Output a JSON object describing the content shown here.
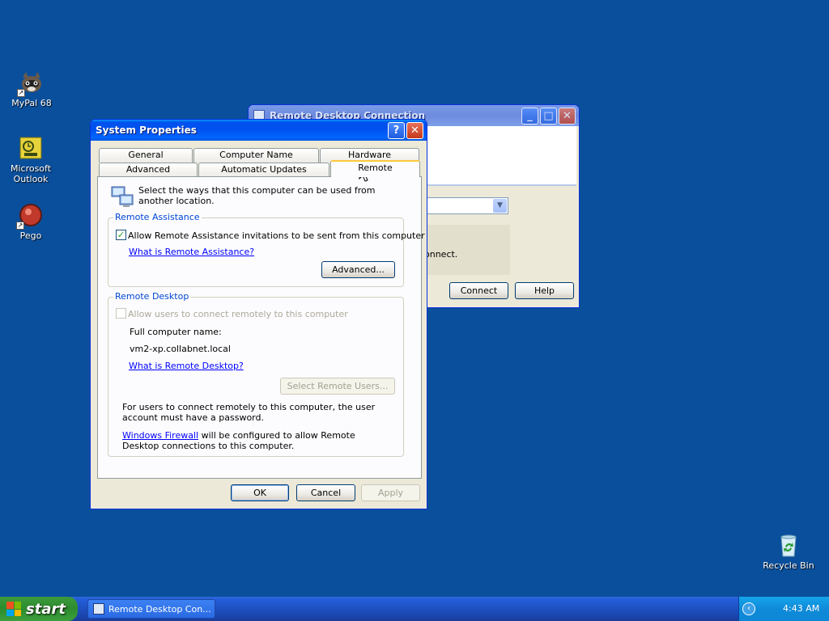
{
  "desktop": {
    "icons": [
      {
        "label": "MyPal 68"
      },
      {
        "label": "Microsoft Outlook"
      },
      {
        "label": "Pego"
      },
      {
        "label": "Recycle Bin"
      }
    ]
  },
  "rdc_window": {
    "title": "Remote Desktop Connection",
    "partial_text": "onnect.",
    "connect_label": "Connect",
    "help_label": "Help"
  },
  "sysprops": {
    "title": "System Properties",
    "tabs_row1": [
      "General",
      "Computer Name",
      "Hardware"
    ],
    "tabs_row2": [
      "Advanced",
      "Automatic Updates",
      "Remote"
    ],
    "active_tab": "Remote",
    "intro": "Select the ways that this computer can be used from another location.",
    "remote_assistance": {
      "group_label": "Remote Assistance",
      "checkbox_label": "Allow Remote Assistance invitations to be sent from this computer",
      "checked": true,
      "link": "What is Remote Assistance?",
      "advanced_button": "Advanced..."
    },
    "remote_desktop": {
      "group_label": "Remote Desktop",
      "checkbox_label": "Allow users to connect remotely to this computer",
      "checked": false,
      "full_name_label": "Full computer name:",
      "full_name_value": "vm2-xp.collabnet.local",
      "link": "What is Remote Desktop?",
      "select_users_button": "Select Remote Users...",
      "note_password": "For users to connect remotely to this computer, the user account must have a password.",
      "firewall_link": "Windows Firewall",
      "firewall_text": " will be configured to allow Remote Desktop connections to this computer."
    },
    "buttons": {
      "ok": "OK",
      "cancel": "Cancel",
      "apply": "Apply"
    }
  },
  "taskbar": {
    "start_label": "start",
    "task_item": "Remote Desktop Con...",
    "clock": "4:43 AM"
  },
  "colors": {
    "desktop": "#0a4f9c",
    "titlebar": "#0050ee",
    "window_face": "#ece9d8",
    "link": "#0000ff",
    "group_label": "#0046d5"
  }
}
